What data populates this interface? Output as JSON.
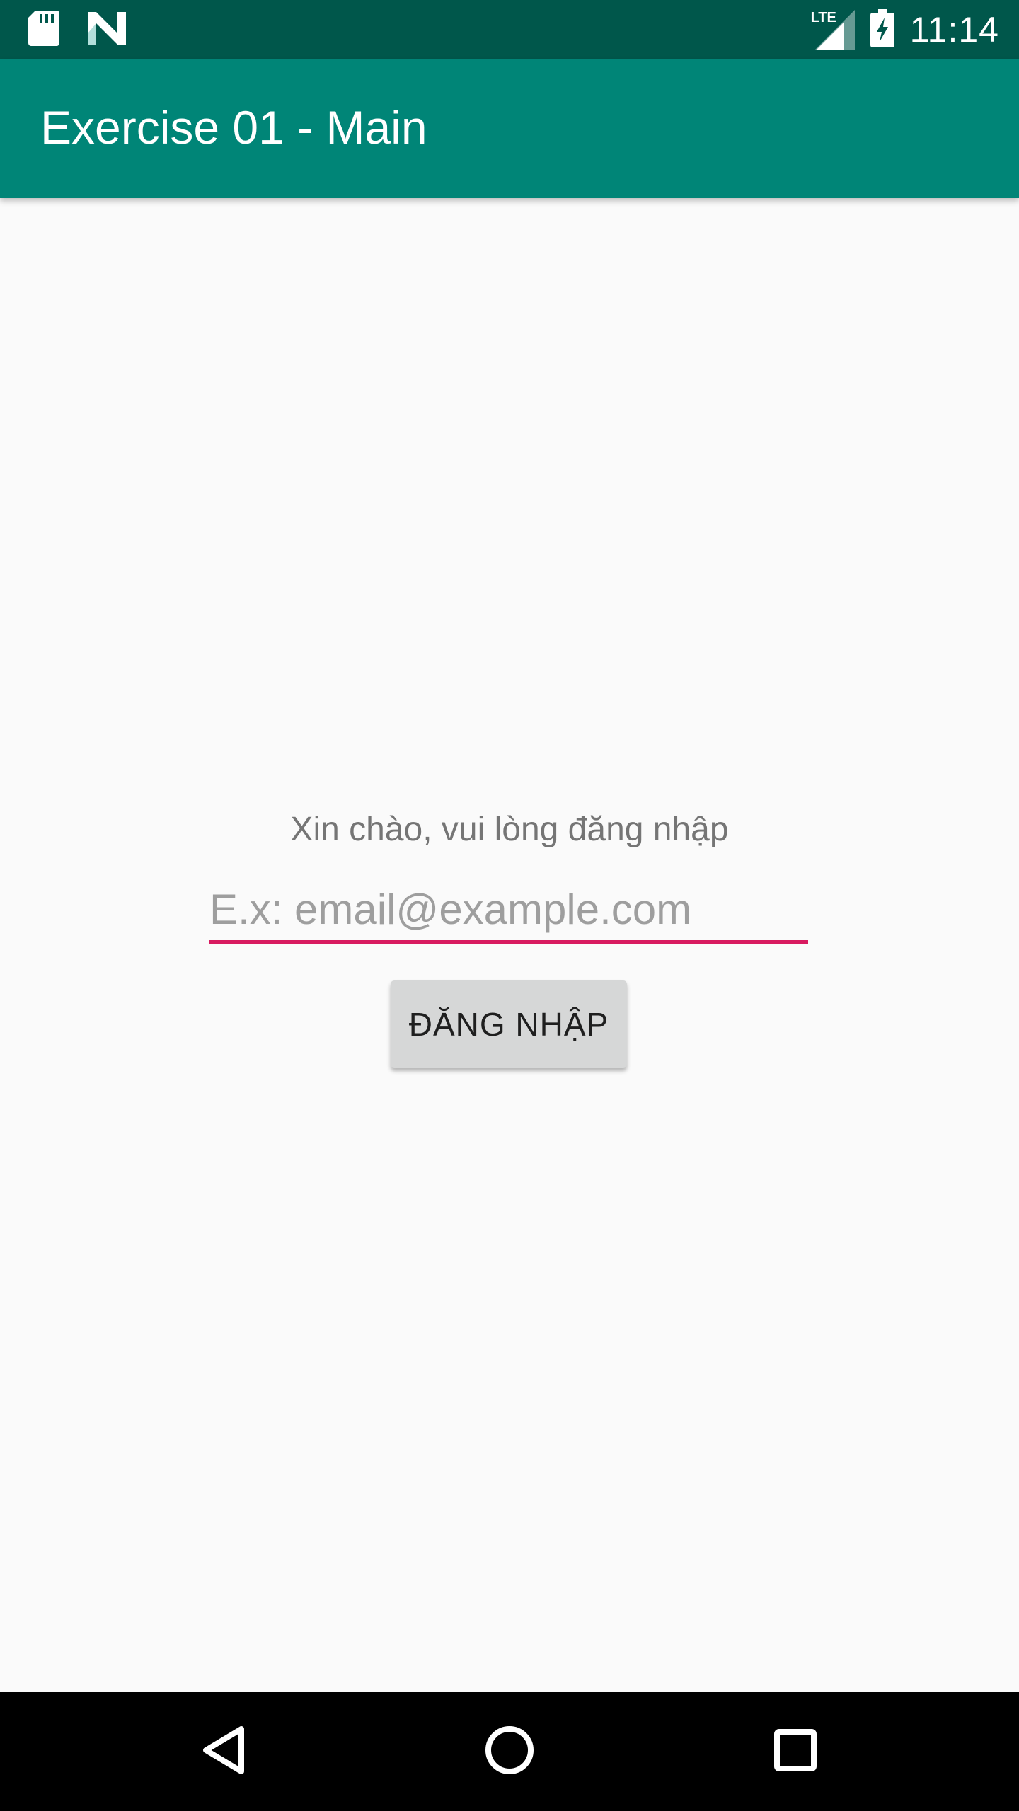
{
  "status_bar": {
    "time": "11:14",
    "network_label": "LTE",
    "icons": [
      "sd-card-icon",
      "n-logo-icon",
      "lte-signal-icon",
      "battery-charging-icon"
    ]
  },
  "app_bar": {
    "title": "Exercise 01 - Main",
    "color": "#008577",
    "status_color": "#00574b"
  },
  "main": {
    "greeting": "Xin chào, vui lòng đăng nhập",
    "email_field": {
      "value": "",
      "placeholder": "E.x: email@example.com",
      "underline_color": "#d81b60"
    },
    "login_button_label": "ĐĂNG NHẬP"
  },
  "nav_bar": {
    "buttons": [
      "back-icon",
      "home-icon",
      "recents-icon"
    ]
  }
}
